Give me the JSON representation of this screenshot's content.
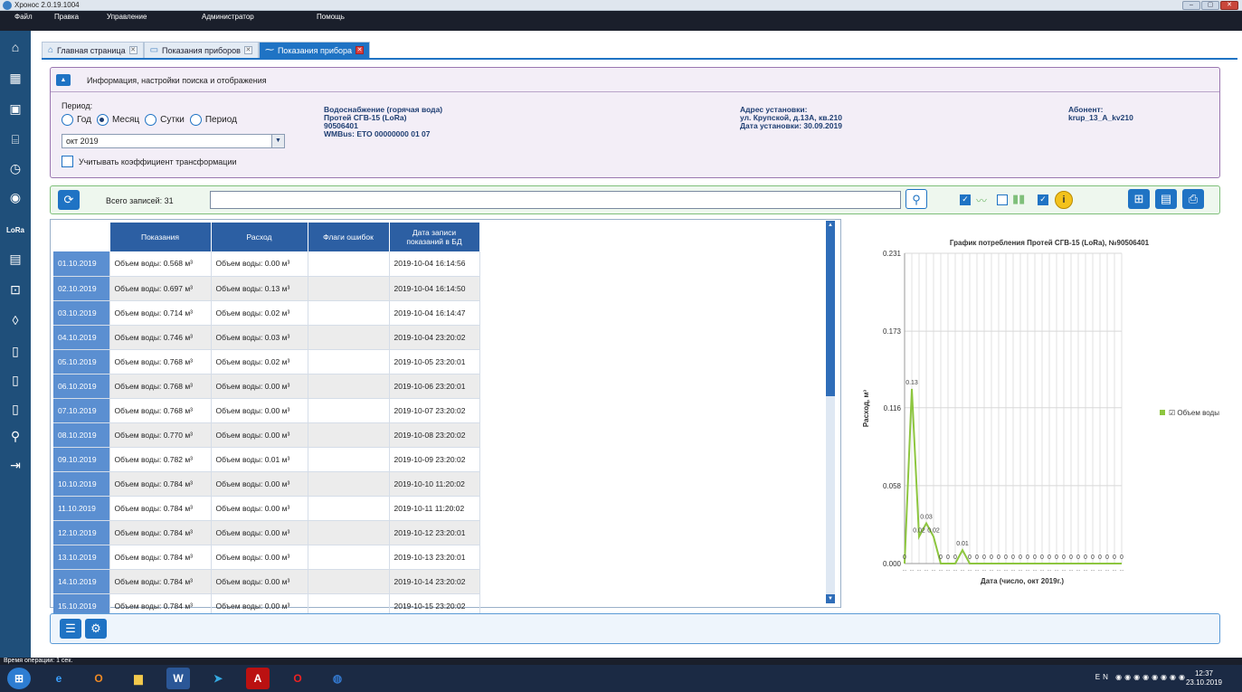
{
  "window": {
    "title": "Хронос 2.0.19.1004",
    "buttons": [
      "–",
      "▢",
      "✕"
    ]
  },
  "menu": [
    "Файл",
    "Правка",
    "Управление",
    "Администратор",
    "Помощь"
  ],
  "tabs": [
    {
      "label": "Главная страница",
      "icon": "home-icon"
    },
    {
      "label": "Показания приборов",
      "icon": "table-icon"
    },
    {
      "label": "Показания прибора",
      "icon": "chart-icon",
      "active": true
    }
  ],
  "info_panel": {
    "header": "Информация, настройки поиска и отображения",
    "period_label": "Период:",
    "radios": [
      "Год",
      "Месяц",
      "Сутки",
      "Период"
    ],
    "radio_selected": "Месяц",
    "select_value": "окт 2019",
    "checkbox_label": "Учитывать коэффициент трансформации",
    "device": [
      "Водоснабжение (горячая вода)",
      "Протей СГВ-15 (LoRa)",
      "90506401",
      "WMBus: ETO 00000000 01 07"
    ],
    "address": [
      "Адрес установки:",
      "ул. Крупской, д.13А, кв.210",
      "Дата установки: 30.09.2019"
    ],
    "subscriber": [
      "Абонент:",
      "krup_13_A_kv210"
    ]
  },
  "toolbar": {
    "count_text": "Всего записей: 31",
    "search_value": ""
  },
  "grid": {
    "headers": [
      "Показания",
      "Расход",
      "Флаги ошибок",
      "Дата записи показаний в БД"
    ],
    "rows": [
      [
        "01.10.2019",
        "Объем воды: 0.568 м³",
        "Объем воды: 0.00 м³",
        "",
        "2019-10-04 16:14:56"
      ],
      [
        "02.10.2019",
        "Объем воды: 0.697 м³",
        "Объем воды: 0.13 м³",
        "",
        "2019-10-04 16:14:50"
      ],
      [
        "03.10.2019",
        "Объем воды: 0.714 м³",
        "Объем воды: 0.02 м³",
        "",
        "2019-10-04 16:14:47"
      ],
      [
        "04.10.2019",
        "Объем воды: 0.746 м³",
        "Объем воды: 0.03 м³",
        "",
        "2019-10-04 23:20:02"
      ],
      [
        "05.10.2019",
        "Объем воды: 0.768 м³",
        "Объем воды: 0.02 м³",
        "",
        "2019-10-05 23:20:01"
      ],
      [
        "06.10.2019",
        "Объем воды: 0.768 м³",
        "Объем воды: 0.00 м³",
        "",
        "2019-10-06 23:20:01"
      ],
      [
        "07.10.2019",
        "Объем воды: 0.768 м³",
        "Объем воды: 0.00 м³",
        "",
        "2019-10-07 23:20:02"
      ],
      [
        "08.10.2019",
        "Объем воды: 0.770 м³",
        "Объем воды: 0.00 м³",
        "",
        "2019-10-08 23:20:02"
      ],
      [
        "09.10.2019",
        "Объем воды: 0.782 м³",
        "Объем воды: 0.01 м³",
        "",
        "2019-10-09 23:20:02"
      ],
      [
        "10.10.2019",
        "Объем воды: 0.784 м³",
        "Объем воды: 0.00 м³",
        "",
        "2019-10-10 11:20:02"
      ],
      [
        "11.10.2019",
        "Объем воды: 0.784 м³",
        "Объем воды: 0.00 м³",
        "",
        "2019-10-11 11:20:02"
      ],
      [
        "12.10.2019",
        "Объем воды: 0.784 м³",
        "Объем воды: 0.00 м³",
        "",
        "2019-10-12 23:20:01"
      ],
      [
        "13.10.2019",
        "Объем воды: 0.784 м³",
        "Объем воды: 0.00 м³",
        "",
        "2019-10-13 23:20:01"
      ],
      [
        "14.10.2019",
        "Объем воды: 0.784 м³",
        "Объем воды: 0.00 м³",
        "",
        "2019-10-14 23:20:02"
      ],
      [
        "15.10.2019",
        "Объем воды: 0.784 м³",
        "Объем воды: 0.00 м³",
        "",
        "2019-10-15 23:20:02"
      ]
    ]
  },
  "chart_data": {
    "type": "line",
    "title": "График потребления Протей СГВ-15 (LoRa), №90506401",
    "xlabel": "Дата (число, окт 2019г.)",
    "ylabel": "Расход, м³",
    "yticks": [
      "0.000",
      "0.058",
      "0.116",
      "0.173",
      "0.231"
    ],
    "ylim": [
      0,
      0.231
    ],
    "grid": true,
    "legend_position": "right",
    "series": [
      {
        "name": "Объем воды",
        "color": "#8dc63f",
        "x": [
          1,
          2,
          3,
          4,
          5,
          6,
          7,
          8,
          9,
          10,
          11,
          12,
          13,
          14,
          15,
          16,
          17,
          18,
          19,
          20,
          21,
          22,
          23,
          24,
          25,
          26,
          27,
          28,
          29,
          30,
          31
        ],
        "values": [
          0,
          0.13,
          0.02,
          0.03,
          0.02,
          0,
          0,
          0,
          0.01,
          0,
          0,
          0,
          0,
          0,
          0,
          0,
          0,
          0,
          0,
          0,
          0,
          0,
          0,
          0,
          0,
          0,
          0,
          0,
          0,
          0,
          0
        ],
        "labels": [
          "0",
          "0.13",
          "0.02",
          "0.03",
          "0.02",
          "0",
          "0",
          "0",
          "0.01",
          "0",
          "0",
          "0",
          "0",
          "0",
          "0",
          "0",
          "0",
          "0",
          "0",
          "0",
          "0",
          "0",
          "0",
          "0",
          "0",
          "0",
          "0",
          "0",
          "0",
          "0",
          "0"
        ]
      }
    ]
  },
  "status": {
    "text": "Время операции: 1 сек."
  },
  "taskbar": {
    "lang": "EN",
    "time": "12:37",
    "date": "23.10.2019"
  }
}
